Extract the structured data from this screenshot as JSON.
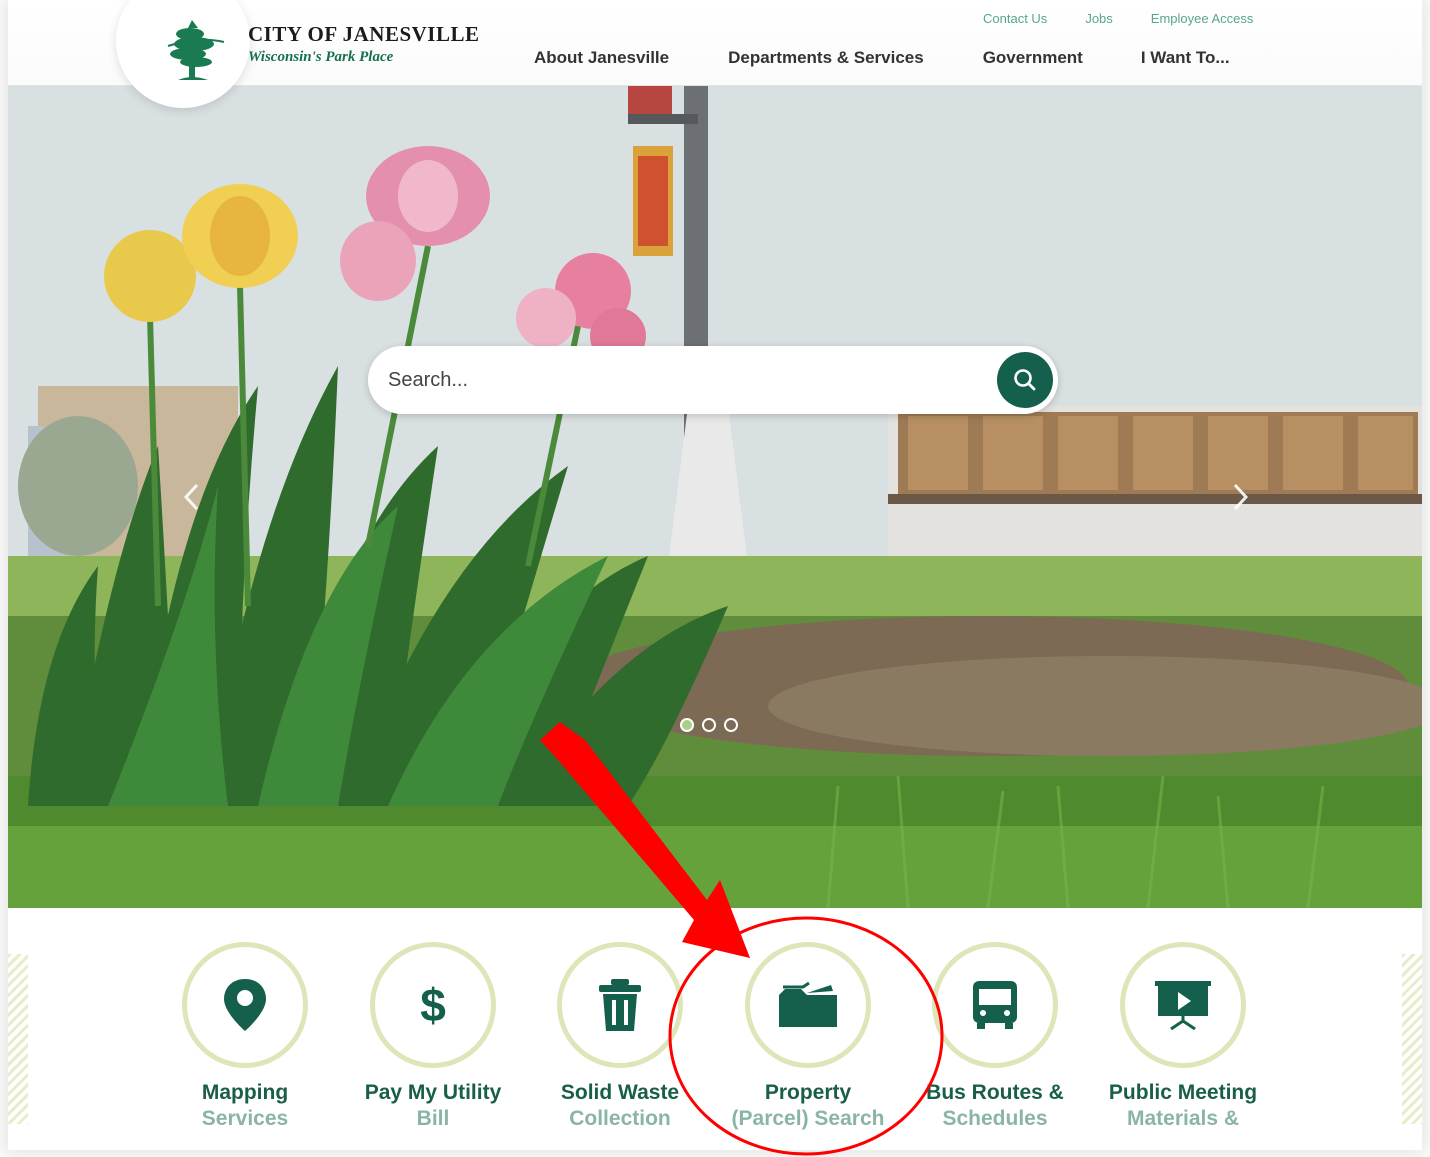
{
  "header": {
    "logo_title": "CITY OF JANESVILLE",
    "logo_subtitle": "Wisconsin's Park Place",
    "utility_links": [
      "Contact Us",
      "Jobs",
      "Employee Access"
    ],
    "nav": [
      "About Janesville",
      "Departments & Services",
      "Government",
      "I Want To..."
    ]
  },
  "search": {
    "placeholder": "Search..."
  },
  "carousel": {
    "prev_icon": "chevron-left-icon",
    "next_icon": "chevron-right-icon",
    "slides": 3,
    "active_slide": 1
  },
  "quicklinks": [
    {
      "line1": "Mapping",
      "line2": "Services",
      "icon": "map-pin-icon"
    },
    {
      "line1": "Pay My Utility",
      "line2": "Bill",
      "icon": "dollar-icon"
    },
    {
      "line1": "Solid Waste",
      "line2": "Collection",
      "icon": "trash-icon"
    },
    {
      "line1": "Property",
      "line2": "(Parcel) Search",
      "icon": "folder-open-icon"
    },
    {
      "line1": "Bus Routes &",
      "line2": "Schedules",
      "icon": "bus-icon"
    },
    {
      "line1": "Public Meeting",
      "line2": "Materials &",
      "icon": "presentation-icon"
    }
  ],
  "colors": {
    "brand_green": "#15604c",
    "circle_border": "#dde6b8",
    "annotation_red": "#ff0000"
  }
}
